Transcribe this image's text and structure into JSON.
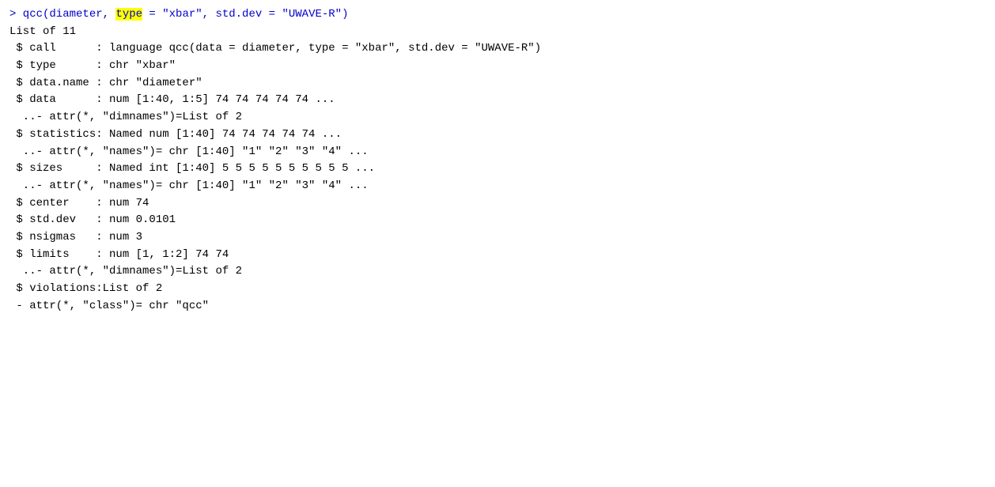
{
  "console": {
    "lines": [
      {
        "id": "line1",
        "text": "> qcc(diameter, type = \"xbar\", std.dev = \"UWAVE-R\")",
        "type": "prompt"
      },
      {
        "id": "line2",
        "text": "List of 11",
        "type": "normal"
      },
      {
        "id": "line3",
        "text": " $ call      : language qcc(data = diameter, type = \"xbar\", std.dev = \"UWAVE-R\")",
        "type": "normal"
      },
      {
        "id": "line4",
        "text": " $ type      : chr \"xbar\"",
        "type": "normal"
      },
      {
        "id": "line5",
        "text": " $ data.name : chr \"diameter\"",
        "type": "normal"
      },
      {
        "id": "line6",
        "text": " $ data      : num [1:40, 1:5] 74 74 74 74 74 ...",
        "type": "normal"
      },
      {
        "id": "line7",
        "text": "  ..- attr(*, \"dimnames\")=List of 2",
        "type": "normal"
      },
      {
        "id": "line8",
        "text": " $ statistics: Named num [1:40] 74 74 74 74 74 ...",
        "type": "normal"
      },
      {
        "id": "line9",
        "text": "  ..- attr(*, \"names\")= chr [1:40] \"1\" \"2\" \"3\" \"4\" ...",
        "type": "normal"
      },
      {
        "id": "line10",
        "text": " $ sizes     : Named int [1:40] 5 5 5 5 5 5 5 5 5 5 ...",
        "type": "normal"
      },
      {
        "id": "line11",
        "text": "  ..- attr(*, \"names\")= chr [1:40] \"1\" \"2\" \"3\" \"4\" ...",
        "type": "normal"
      },
      {
        "id": "line12",
        "text": " $ center    : num 74",
        "type": "normal"
      },
      {
        "id": "line13",
        "text": " $ std.dev   : num 0.0101",
        "type": "normal"
      },
      {
        "id": "line14",
        "text": " $ nsigmas   : num 3",
        "type": "normal"
      },
      {
        "id": "line15",
        "text": " $ limits    : num [1, 1:2] 74 74",
        "type": "normal"
      },
      {
        "id": "line16",
        "text": "  ..- attr(*, \"dimnames\")=List of 2",
        "type": "normal"
      },
      {
        "id": "line17",
        "text": " $ violations:List of 2",
        "type": "normal"
      },
      {
        "id": "line18",
        "text": " - attr(*, \"class\")= chr \"qcc\"",
        "type": "normal"
      }
    ]
  }
}
